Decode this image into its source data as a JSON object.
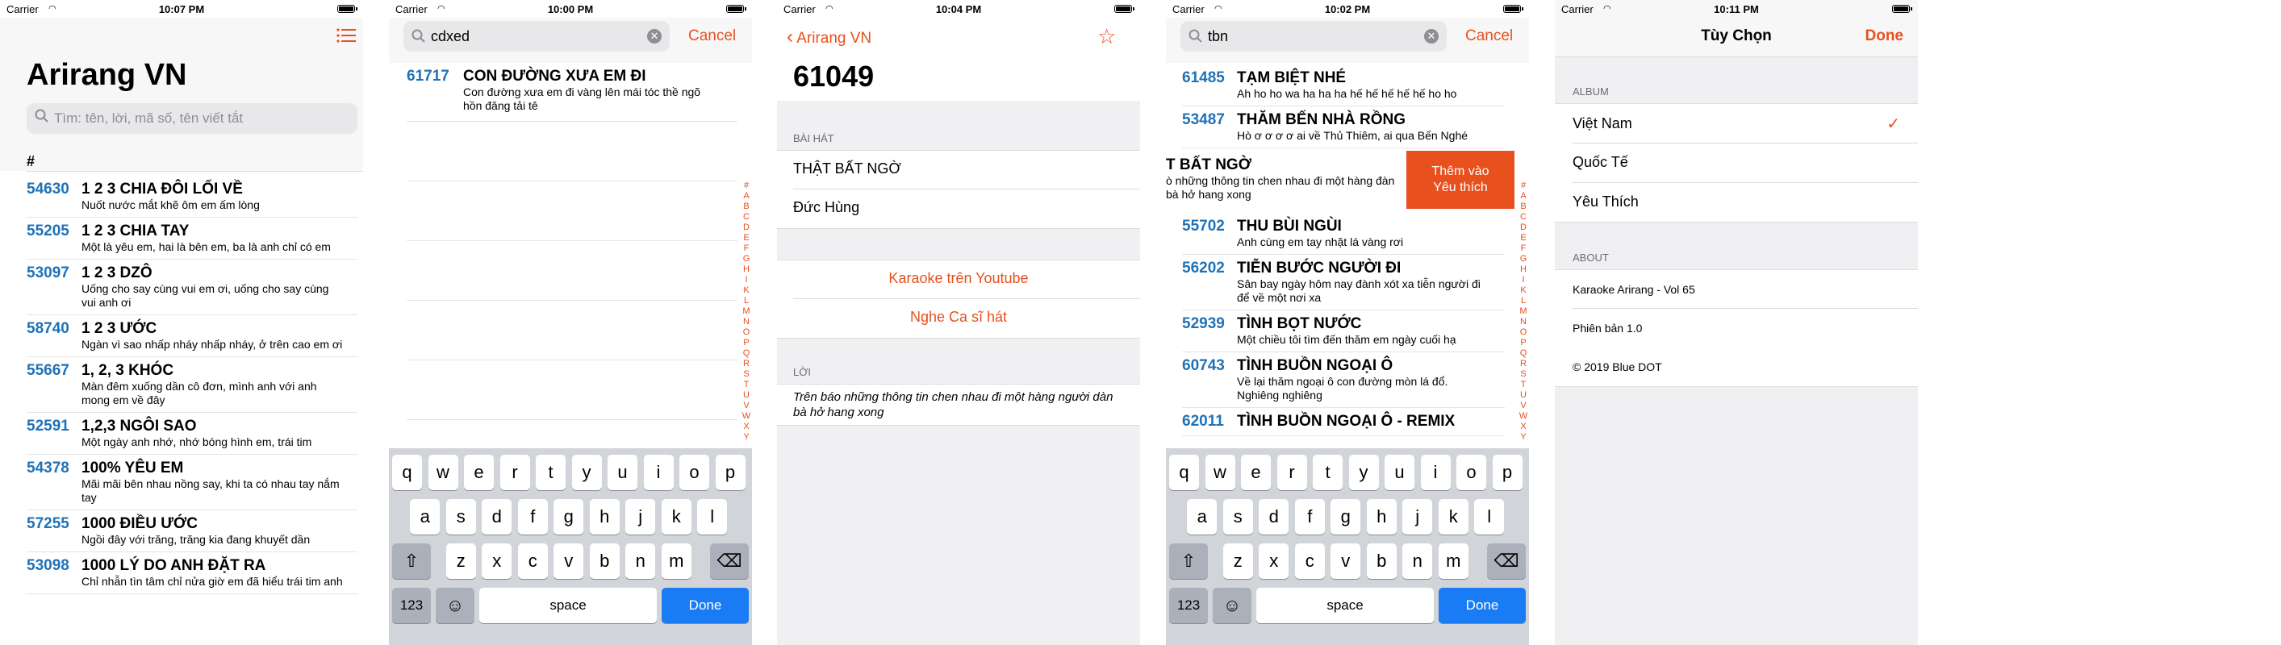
{
  "status": {
    "carrier": "Carrier",
    "times": [
      "10:07 PM",
      "10:00 PM",
      "10:04 PM",
      "10:02 PM",
      "10:11 PM"
    ]
  },
  "index_letters": [
    "#",
    "A",
    "B",
    "C",
    "D",
    "E",
    "F",
    "G",
    "H",
    "I",
    "K",
    "L",
    "M",
    "N",
    "O",
    "P",
    "Q",
    "R",
    "S",
    "T",
    "U",
    "V",
    "W",
    "X",
    "Y"
  ],
  "screen1": {
    "title": "Arirang VN",
    "search_placeholder": "Tìm: tên, lời, mã số, tên viết tắt",
    "section": "#",
    "songs": [
      {
        "num": "54630",
        "title": "1 2 3 CHIA ĐÔI LỐI VỀ",
        "lyric": "Nuốt nước mắt khẽ ôm em ấm lòng"
      },
      {
        "num": "55205",
        "title": "1 2 3 CHIA TAY",
        "lyric": "Một là yêu em, hai là bên em, ba là anh chỉ có em"
      },
      {
        "num": "53097",
        "title": "1 2 3 DZÔ",
        "lyric": "Uống cho say cùng vui em ơi, uống cho say cùng vui anh ơi"
      },
      {
        "num": "58740",
        "title": "1 2 3 ƯỚC",
        "lyric": "Ngàn vì sao nhấp nháy nhấp nháy, ở trên cao em ơi"
      },
      {
        "num": "55667",
        "title": "1, 2, 3 KHÓC",
        "lyric": "Màn đêm xuống dần cô đơn, mình anh với anh mong em về đây"
      },
      {
        "num": "52591",
        "title": "1,2,3 NGÔI SAO",
        "lyric": "Một ngày anh nhớ, nhớ bóng hình em, trái tim"
      },
      {
        "num": "54378",
        "title": "100% YÊU EM",
        "lyric": "Mãi mãi bên nhau nồng say, khi ta có nhau tay nắm tay"
      },
      {
        "num": "57255",
        "title": "1000 ĐIỀU ƯỚC",
        "lyric": "Ngồi đây với trăng, trăng kia đang khuyết dần"
      },
      {
        "num": "53098",
        "title": "1000 LÝ DO ANH ĐẶT RA",
        "lyric": "Chỉ nhẫn tìn tâm chỉ nửa giờ em đã hiểu trái tim anh"
      }
    ]
  },
  "screen2": {
    "search_value": "cdxed",
    "cancel": "Cancel",
    "result": {
      "num": "61717",
      "title": "CON ĐƯỜNG XƯA EM ĐI",
      "lyric": "Con đường xưa em đi  vàng lên mái tóc thề  ngõ hồn đăng tải tê"
    }
  },
  "screen3": {
    "back": "Arirang VN",
    "code": "61049",
    "section_song": "BÀI HÁT",
    "song_title": "THẬT BẤT NGỜ",
    "artist": "Đức Hùng",
    "actions": [
      "Karaoke trên Youtube",
      "Nghe Ca sĩ hát"
    ],
    "section_lyric": "LỜI",
    "lyric": "Trên báo những thông tin chen nhau đi một hàng người dàn bà hở hang xong"
  },
  "screen4": {
    "search_value": "tbn",
    "cancel": "Cancel",
    "swipe_action": "Thêm vào Yêu thích",
    "swiped": {
      "title": "T BẤT NGỜ",
      "lyric": "ò những thông tin chen nhau đi một hàng đàn bà hở hang xong"
    },
    "songs_top": [
      {
        "num": "61485",
        "title": "TẠM BIỆT NHÉ",
        "lyric": "Ah ho ho wa ha ha ha hế hế hế hế hế ho ho"
      },
      {
        "num": "53487",
        "title": "THĂM BẾN NHÀ RỒNG",
        "lyric": "Hò ơ ơ ơ ơ ai về Thủ Thiêm, ai qua Bến Nghé"
      }
    ],
    "songs_bottom": [
      {
        "num": "55702",
        "title": "THU BÙI NGÙI",
        "lyric": "Anh cùng em tay nhặt lá vàng rơi"
      },
      {
        "num": "56202",
        "title": "TIỄN BƯỚC NGƯỜI ĐI",
        "lyric": "Sân bay ngày hôm nay đành xót xa tiễn người đi để về một nơi xa"
      },
      {
        "num": "52939",
        "title": "TÌNH BỌT NƯỚC",
        "lyric": "Một chiều tôi tìm đến thăm em ngày cuối hạ"
      },
      {
        "num": "60743",
        "title": "TÌNH BUỒN NGOẠI Ô",
        "lyric": "Về lại thăm ngoại ô con đường mòn lá đổ. Nghiêng nghiêng"
      },
      {
        "num": "62011",
        "title": "TÌNH BUỒN NGOẠI Ô - REMIX",
        "lyric": ""
      }
    ]
  },
  "screen5": {
    "title": "Tùy Chọn",
    "done": "Done",
    "section_album": "ALBUM",
    "albums": [
      "Việt Nam",
      "Quốc Tế",
      "Yêu Thích"
    ],
    "checkmark": "✓",
    "section_about": "ABOUT",
    "about": [
      "Karaoke Arirang - Vol 65",
      "Phiên bản 1.0",
      "© 2019 Blue DOT"
    ]
  },
  "keyboard": {
    "row1": [
      "q",
      "w",
      "e",
      "r",
      "t",
      "y",
      "u",
      "i",
      "o",
      "p"
    ],
    "row2": [
      "a",
      "s",
      "d",
      "f",
      "g",
      "h",
      "j",
      "k",
      "l"
    ],
    "row3": [
      "z",
      "x",
      "c",
      "v",
      "b",
      "n",
      "m"
    ],
    "numbers": "123",
    "space": "space",
    "done": "Done"
  }
}
